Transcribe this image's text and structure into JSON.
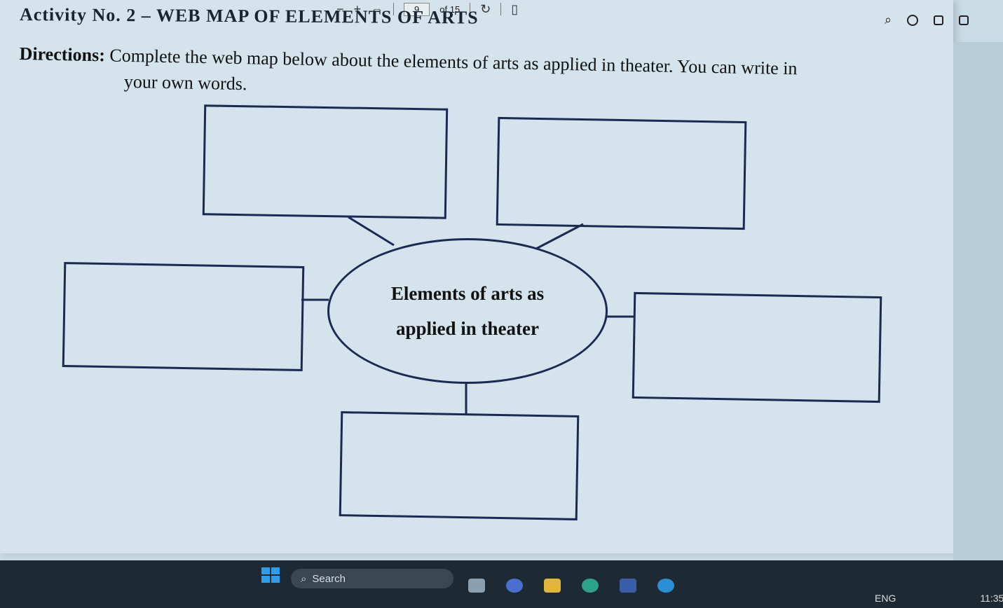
{
  "toolbar": {
    "minus": "−",
    "plus": "+",
    "page_current": "9",
    "page_total": "of 15"
  },
  "document": {
    "activity_title": "Activity No. 2 – WEB MAP OF ELEMENTS OF ARTS",
    "directions_label": "Directions:",
    "directions_text_line1": " Complete the web map below about the elements of arts as applied in theater. You can write in",
    "directions_text_line2": "your own words.",
    "center_line1": "Elements of arts as",
    "center_line2": "applied in theater"
  },
  "taskbar": {
    "search_placeholder": "Search",
    "language": "ENG",
    "time": "11:35"
  },
  "colors": {
    "box_border": "#1a2a55",
    "page_bg": "#d4e3ec",
    "taskbar_bg": "#1e2a33",
    "start_blue": "#2f9ee8"
  }
}
